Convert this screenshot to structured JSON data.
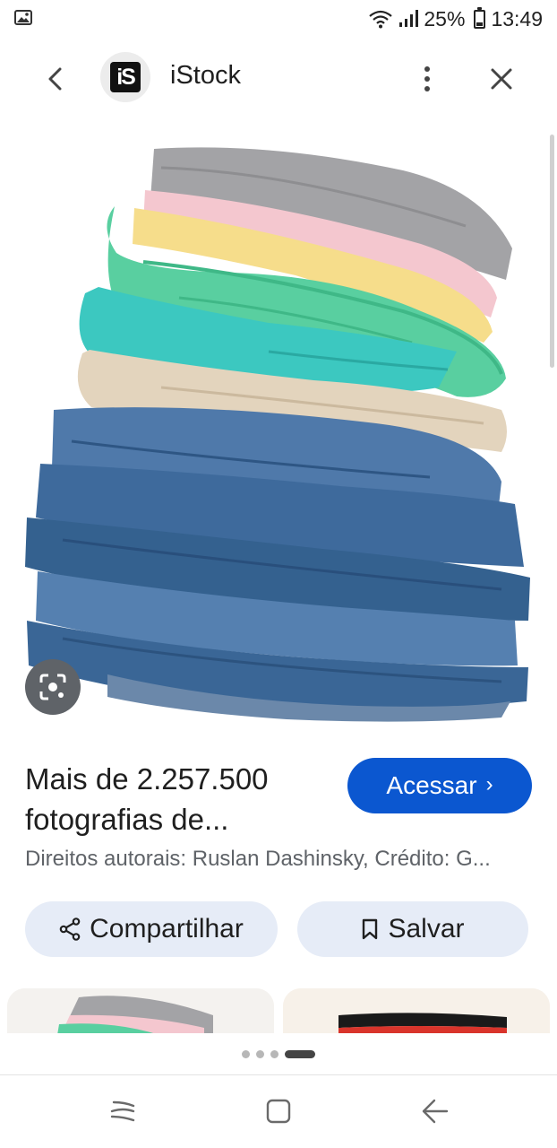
{
  "status_bar": {
    "battery": "25%",
    "time": "13:49",
    "icons": [
      "gallery-icon",
      "wifi-icon",
      "signal-icon",
      "battery-icon"
    ]
  },
  "header": {
    "logo_text": "iS",
    "site_name": "iStock",
    "icons": [
      "back-arrow-icon",
      "more-vert-icon",
      "close-icon"
    ]
  },
  "image": {
    "alt": "Pilha de roupas dobradas e jeans"
  },
  "result": {
    "title": "Mais de 2.257.500 fotografias de...",
    "visit_label": "Acessar",
    "visit_chevron": "›",
    "credits": "Direitos autorais: Ruslan Dashinsky, Crédito: G..."
  },
  "actions": {
    "share_label": "Compartilhar",
    "save_label": "Salvar"
  },
  "pager": {
    "count": 4,
    "active_index": 3
  },
  "colors": {
    "accent": "#0b57d0",
    "pill_bg": "#e6ecf7",
    "secondary_text": "#5f6368"
  }
}
